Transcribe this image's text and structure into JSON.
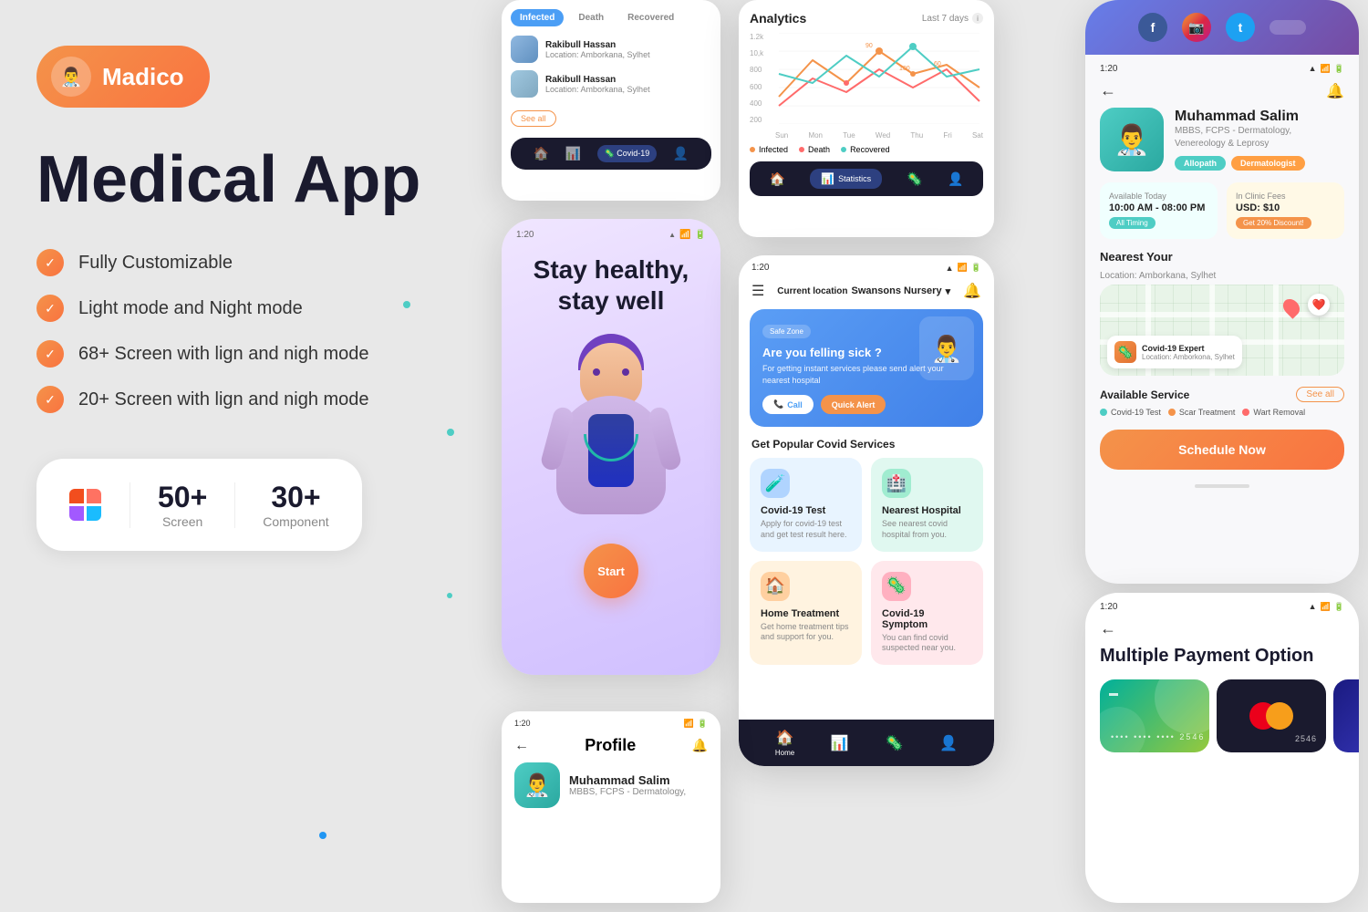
{
  "brand": {
    "name": "Madico",
    "tagline": "Medical App"
  },
  "features": [
    "Fully Customizable",
    "Light mode and Night mode",
    "68+ Screen with lign and nigh mode",
    "20+ Screen with lign and nigh mode"
  ],
  "stats": {
    "screens": "50+",
    "screens_label": "Screen",
    "components": "30+",
    "components_label": "Component"
  },
  "screen1": {
    "tabs": [
      "Infected",
      "Death",
      "Recovered"
    ],
    "patients": [
      {
        "name": "Rakibull Hassan",
        "location": "Location: Amborkana, Sylhet"
      },
      {
        "name": "Rakibull Hassan",
        "location": "Location: Amborkana, Sylhet"
      }
    ],
    "see_all": "See all"
  },
  "screen2": {
    "title": "Analytics",
    "period": "Last 7 days",
    "y_labels": [
      "1.2k",
      "10,k",
      "800",
      "600",
      "400",
      "200"
    ],
    "x_labels": [
      "Sun",
      "Mon",
      "Tue",
      "Wed",
      "Thu",
      "Fri",
      "Sat"
    ],
    "legend": [
      "Infected",
      "Death",
      "Recovered"
    ],
    "chart_values": {
      "infected": [
        400,
        900,
        600,
        1000,
        700,
        800,
        500
      ],
      "death": [
        300,
        600,
        400,
        700,
        500,
        700,
        300
      ],
      "recovered": [
        600,
        500,
        800,
        600,
        900,
        600,
        700
      ]
    }
  },
  "screen3": {
    "headline": "Stay healthy, stay well",
    "start_btn": "Start"
  },
  "screen4": {
    "time": "1:20",
    "location": "Swansons Nursery",
    "banner": {
      "title": "Are you felling sick ?",
      "desc": "For getting instant services please send alert your nearest hospital",
      "badge": "Safe Zone",
      "btn_call": "Call",
      "btn_alert": "Quick Alert"
    },
    "section_title": "Get Popular Covid Services",
    "cards": [
      {
        "title": "Covid-19 Test",
        "desc": "Apply for covid-19 test and get test result here."
      },
      {
        "title": "Nearest Hospital",
        "desc": "See nearest covid hospital from you."
      },
      {
        "title": "Home Treatment",
        "desc": "Get home treatment tips and support for you."
      },
      {
        "title": "Covid-19 Symptom",
        "desc": "You can find covid suspected near you."
      }
    ],
    "nav": [
      "Home",
      "Stats",
      "Covid",
      "Profile"
    ]
  },
  "screen5": {
    "time": "1:20",
    "title": "Profile",
    "doctor": {
      "name": "Muhammad Salim",
      "specialty": "MBBS, FCPS - Dermatology,"
    }
  },
  "right_panel": {
    "time": "1:20",
    "doctor": {
      "name": "Muhammad Salim",
      "specialty": "MBBS, FCPS - Dermatology, Venereology & Leprosy",
      "tag1": "Allopath",
      "tag2": "Dermatologist"
    },
    "availability": {
      "title": "Available Today",
      "hours": "10:00 AM - 08:00 PM",
      "timing_badge": "All Timing",
      "fee_title": "In Clinic Fees",
      "fee": "USD: $10",
      "discount_badge": "Get 20% Discount!"
    },
    "map_section": "Nearest Your",
    "map_location": "Location: Amborkana, Sylhet",
    "expert": {
      "name": "Covid-19 Expert",
      "location": "Location: Amborkona, Sylhet"
    },
    "available_service": "Available Service",
    "see_all": "See all",
    "services": [
      "Covid-19 Test",
      "Scar Treatment",
      "Wart Removal"
    ],
    "schedule_btn": "Schedule Now"
  },
  "payment": {
    "time": "1:20",
    "title": "Multiple Payment Option",
    "card_number": "2546",
    "card_number2": "2546"
  }
}
